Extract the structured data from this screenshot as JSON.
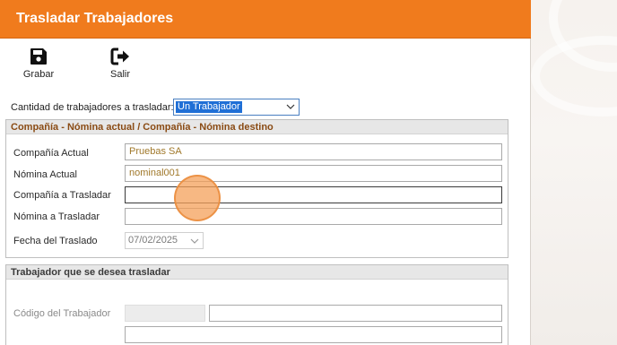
{
  "window": {
    "title": "Trasladar Trabajadores"
  },
  "toolbar": {
    "save_label": "Grabar",
    "save_icon": "floppy-disk-icon",
    "exit_label": "Salir",
    "exit_icon": "exit-arrow-icon"
  },
  "quantity": {
    "label": "Cantidad de trabajadores a trasladar:",
    "selected": "Un Trabajador"
  },
  "company_section": {
    "header": "Compañía - Nómina actual / Compañía - Nómina destino",
    "current_company_label": "Compañía Actual",
    "current_company_value": "Pruebas SA",
    "current_payroll_label": "Nómina Actual",
    "current_payroll_value": "nominal001",
    "target_company_label": "Compañía a Trasladar",
    "target_company_value": "",
    "target_payroll_label": "Nómina a Trasladar",
    "target_payroll_value": "",
    "transfer_date_label": "Fecha del Traslado",
    "transfer_date_value": "07/02/2025"
  },
  "worker_section": {
    "header": "Trabajador que se desea trasladar",
    "worker_code_label": "Código del Trabajador",
    "worker_code_value": "",
    "worker_name_value": ""
  },
  "colors": {
    "title_bar": "#f07b1d",
    "section_header_text": "#8a4b14",
    "selection_highlight": "#1f6fd6"
  }
}
